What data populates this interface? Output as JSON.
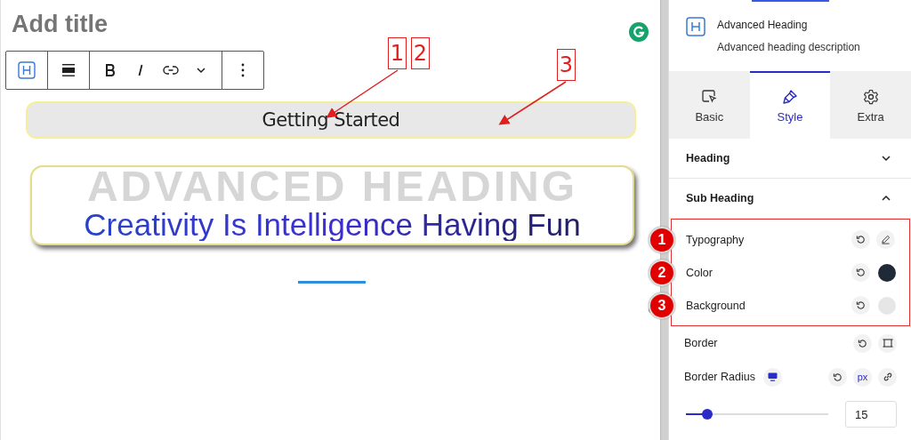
{
  "editor": {
    "title_placeholder": "Add title",
    "subheading": "Getting Started",
    "watermark": "ADVANCED HEADING",
    "heading": "Creativity Is Intelligence Having Fun"
  },
  "callouts": [
    {
      "label": "1"
    },
    {
      "label": "2"
    },
    {
      "label": "3"
    }
  ],
  "panel": {
    "block_title": "Advanced Heading",
    "block_description": "Advanced heading description",
    "tabs": [
      {
        "label": "Basic",
        "kind": "basic",
        "selected": false
      },
      {
        "label": "Style",
        "kind": "style",
        "selected": true
      },
      {
        "label": "Extra",
        "kind": "extra",
        "selected": false
      }
    ],
    "sections": [
      {
        "title": "Heading",
        "expanded": false
      },
      {
        "title": "Sub Heading",
        "expanded": true
      }
    ],
    "controls": [
      {
        "kind": "typography",
        "label": "Typography",
        "marker": "1"
      },
      {
        "kind": "color",
        "label": "Color",
        "color": "#1f2937",
        "marker": "2"
      },
      {
        "kind": "color",
        "label": "Background",
        "color": "#e6e6e6",
        "marker": "3"
      },
      {
        "kind": "border",
        "label": "Border"
      },
      {
        "kind": "radius",
        "label": "Border Radius",
        "unit": "px",
        "level": 0.15,
        "value": "15"
      }
    ]
  }
}
